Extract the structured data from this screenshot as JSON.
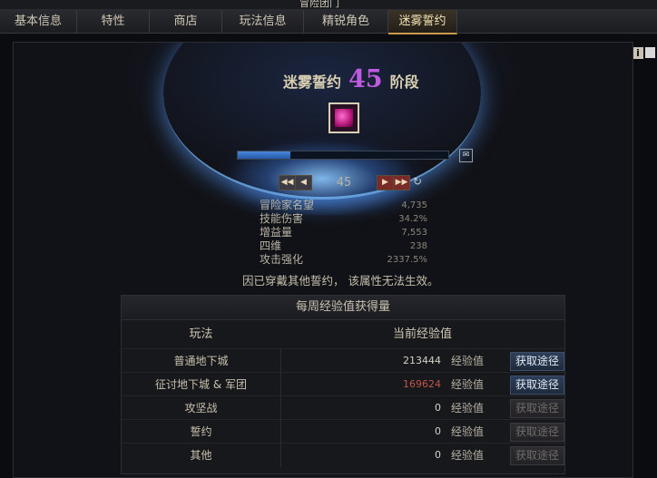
{
  "window": {
    "title": "冒险团门"
  },
  "tabs": [
    {
      "label": "基本信息"
    },
    {
      "label": "特性"
    },
    {
      "label": "商店"
    },
    {
      "label": "玩法信息"
    },
    {
      "label": "精锐角色"
    },
    {
      "label": "迷雾誓约",
      "active": true
    }
  ],
  "header_icons": {
    "info": "i",
    "grid": "grid-icon"
  },
  "oath": {
    "title_prefix": "迷雾誓约",
    "level": "45",
    "title_suffix": "阶段",
    "progress_fraction": 0.25
  },
  "level_nav": {
    "first": "◀◀",
    "prev": "◀",
    "value": "45",
    "next": "▶",
    "last": "▶▶",
    "refresh": "↻"
  },
  "stats": [
    {
      "label": "冒险家名望",
      "value": "4,735"
    },
    {
      "label": "技能伤害",
      "value": "34.2%"
    },
    {
      "label": "增益量",
      "value": "7,553"
    },
    {
      "label": "四维",
      "value": "238"
    },
    {
      "label": "攻击强化",
      "value": "2337.5%"
    }
  ],
  "notice": "因已穿戴其他誓约， 该属性无法生效。",
  "weekly": {
    "title": "每周经验值获得量",
    "col_mode": "玩法",
    "col_exp": "当前经验值",
    "rows": [
      {
        "mode": "普通地下城",
        "value": "213444",
        "unit": "经验值",
        "button": "获取途径",
        "enabled": true,
        "highlight": false
      },
      {
        "mode": "征讨地下城 & 军团",
        "value": "169624",
        "unit": "经验值",
        "button": "获取途径",
        "enabled": true,
        "highlight": true
      },
      {
        "mode": "攻坚战",
        "value": "0",
        "unit": "经验值",
        "button": "获取途径",
        "enabled": false,
        "highlight": false
      },
      {
        "mode": "誓约",
        "value": "0",
        "unit": "经验值",
        "button": "获取途径",
        "enabled": false,
        "highlight": false
      },
      {
        "mode": "其他",
        "value": "0",
        "unit": "经验值",
        "button": "获取途径",
        "enabled": false,
        "highlight": false
      }
    ]
  },
  "colors": {
    "accent": "#c05ae0",
    "tab_active": "#c89a4a",
    "progress": "#4a86d9",
    "exp_red": "#c0554a"
  }
}
